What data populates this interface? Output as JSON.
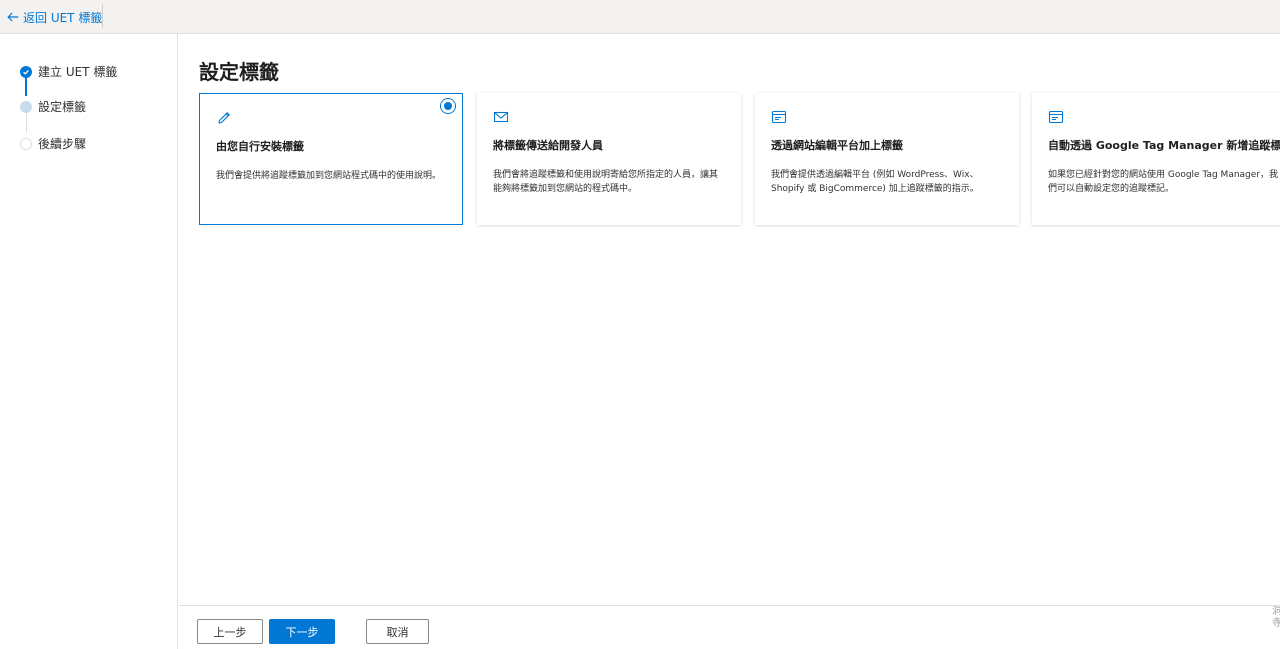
{
  "topbar": {
    "back_label": "返回 UET 標籤"
  },
  "stepper": {
    "steps": [
      {
        "label": "建立 UET 標籤",
        "state": "done"
      },
      {
        "label": "設定標籤",
        "state": "current"
      },
      {
        "label": "後續步驟",
        "state": "future"
      }
    ]
  },
  "main": {
    "title": "設定標籤",
    "cards": [
      {
        "icon": "pencil-icon",
        "title": "由您自行安裝標籤",
        "desc": "我們會提供將追蹤標籤加到您網站程式碼中的使用說明。",
        "selected": true
      },
      {
        "icon": "mail-icon",
        "title": "將標籤傳送給開發人員",
        "desc": "我們會將追蹤標籤和使用說明寄給您所指定的人員，讓其能夠將標籤加到您網站的程式碼中。",
        "selected": false
      },
      {
        "icon": "browser-window-icon",
        "title": "透過網站編輯平台加上標籤",
        "desc": "我們會提供透過編輯平台 (例如 WordPress、Wix、Shopify 或 BigCommerce) 加上追蹤標籤的指示。",
        "selected": false
      },
      {
        "icon": "browser-window-icon",
        "title": "自動透過 Google Tag Manager 新增追蹤標籤",
        "desc": "如果您已經針對您的網站使用 Google Tag Manager，我們可以自動設定您的追蹤標記。",
        "selected": false
      }
    ]
  },
  "footer": {
    "prev_label": "上一步",
    "next_label": "下一步",
    "cancel_label": "取消",
    "edge_text": "洞 寺"
  },
  "colors": {
    "accent": "#0078d4",
    "current_step": "#c7dcef"
  }
}
